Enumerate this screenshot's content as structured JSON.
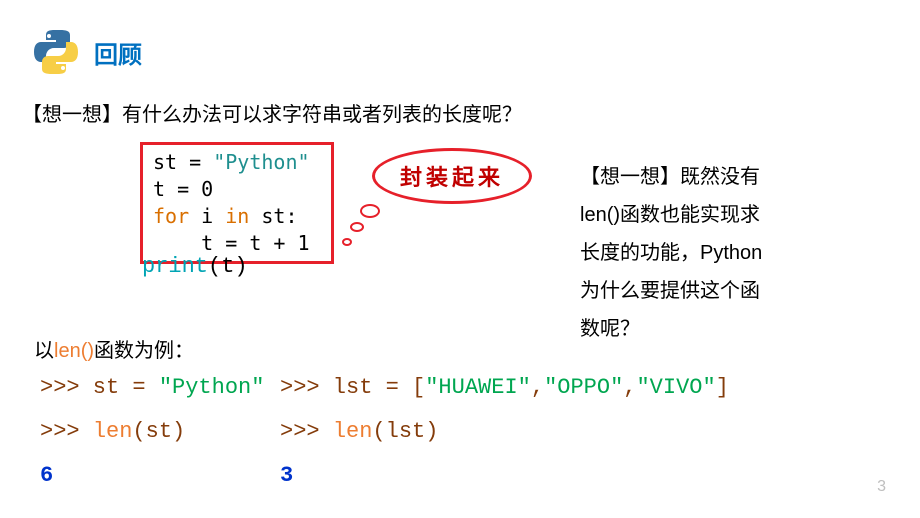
{
  "header": {
    "title": "回顾"
  },
  "question1_pre": "【想一想】",
  "question1_post": "有什么办法可以求字符串或者列表的长度呢？",
  "codebox": {
    "l1a": "st = ",
    "l1b": "\"Python\"",
    "l2": "t = 0",
    "l3a": "for",
    "l3b": " i ",
    "l3c": "in",
    "l3d": " st:",
    "l4": "    t = t + 1"
  },
  "printline": {
    "a": "print",
    "b": "(t)"
  },
  "thought": "封装起来",
  "side": {
    "t1a": "【想一想】",
    "t1b": "既然没有",
    "t2": "len()函数也能实现求",
    "t3": "长度的功能，Python",
    "t4": "为什么要提供这个函",
    "t5": "数呢？"
  },
  "ex_label_a": "以",
  "ex_label_b": "len()",
  "ex_label_c": "函数为例：",
  "repl_left": {
    "l1a": ">>> st = ",
    "l1b": "\"Python\"",
    "l2a": ">>> ",
    "l2b": "len",
    "l2c": "(st)",
    "l3": "6"
  },
  "repl_right": {
    "l1a": ">>> lst = [",
    "l1b": "\"HUAWEI\"",
    "l1c": ",",
    "l1d": "\"OPPO\"",
    "l1e": ",",
    "l1f": "\"VIVO\"",
    "l1g": "]",
    "l2a": ">>> ",
    "l2b": "len",
    "l2c": "(lst)",
    "l3": "3"
  },
  "page": "3"
}
